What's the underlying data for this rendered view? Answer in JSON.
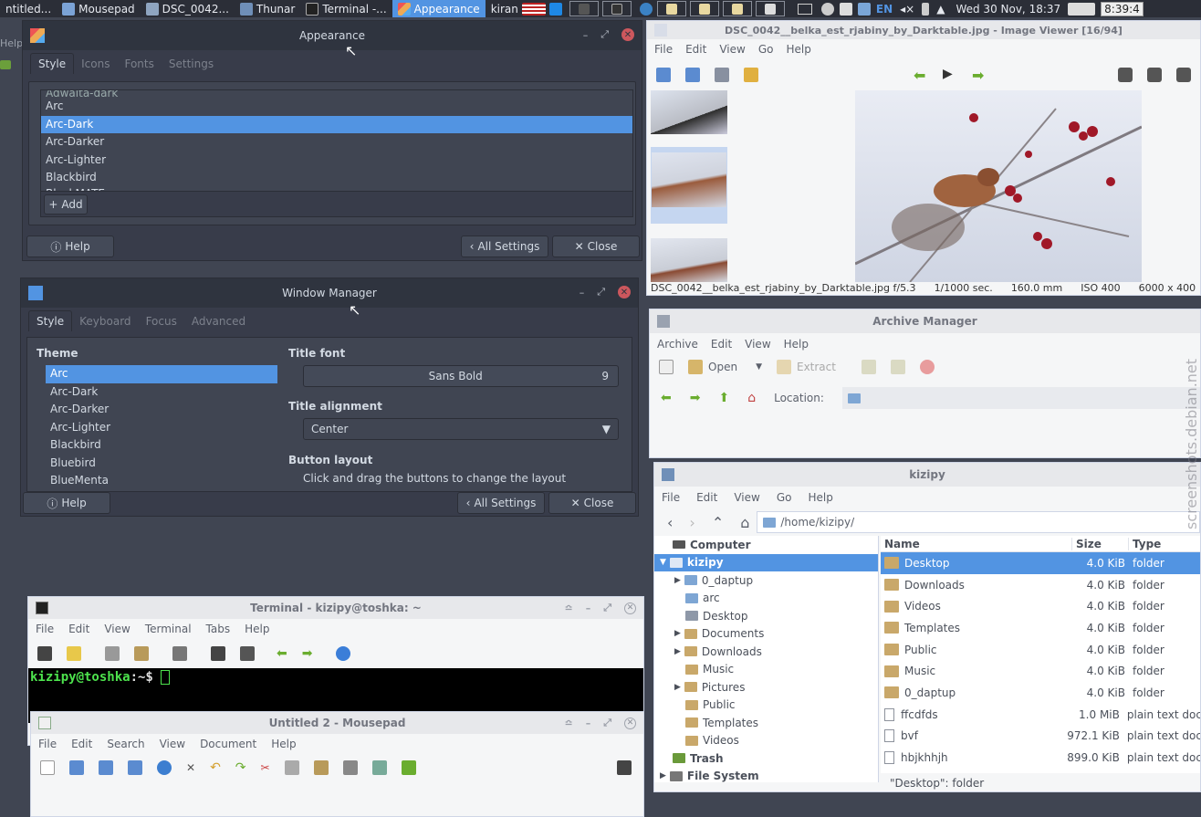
{
  "taskbar": {
    "tasks": [
      {
        "label": "ntitled...",
        "active": false
      },
      {
        "label": "Mousepad",
        "active": false
      },
      {
        "label": "DSC_0042...",
        "active": false
      },
      {
        "label": "Thunar",
        "active": false
      },
      {
        "label": "Terminal -...",
        "active": false
      },
      {
        "label": "Appearance",
        "active": true
      },
      {
        "label": "kiran",
        "active": false
      }
    ],
    "lang": "EN",
    "datetime": "Wed 30 Nov, 18:37",
    "clock": "8:39:4"
  },
  "appearance": {
    "title": "Appearance",
    "tabs": [
      "Style",
      "Icons",
      "Fonts",
      "Settings"
    ],
    "themes_partial_top": "Adwaita-dark",
    "themes": [
      "Arc",
      "Arc-Dark",
      "Arc-Darker",
      "Arc-Lighter",
      "Blackbird"
    ],
    "selected": "Arc-Dark",
    "themes_partial_bottom": "BlackMATE",
    "add_label": "Add",
    "help_label": "Help",
    "all_settings_label": "All Settings",
    "close_label": "Close"
  },
  "window_manager": {
    "title": "Window Manager",
    "tabs": [
      "Style",
      "Keyboard",
      "Focus",
      "Advanced"
    ],
    "theme_label": "Theme",
    "themes": [
      "Arc",
      "Arc-Dark",
      "Arc-Darker",
      "Arc-Lighter",
      "Blackbird",
      "Bluebird",
      "BlueMenta"
    ],
    "selected": "Arc",
    "title_font_label": "Title font",
    "title_font_value": "Sans Bold",
    "title_font_size": "9",
    "title_alignment_label": "Title alignment",
    "title_alignment_value": "Center",
    "button_layout_label": "Button layout",
    "button_layout_hint": "Click and drag the buttons to change the layout",
    "help_label": "Help",
    "all_settings_label": "All Settings",
    "close_label": "Close"
  },
  "image_viewer": {
    "title": "DSC_0042__belka_est_rjabiny_by_Darktable.jpg - Image Viewer [16/94]",
    "menu": [
      "File",
      "Edit",
      "View",
      "Go",
      "Help"
    ],
    "status_filename": "DSC_0042__belka_est_rjabiny_by_Darktable.jpg",
    "aperture": "f/5.3",
    "shutter": "1/1000 sec.",
    "focal": "160.0 mm",
    "iso": "ISO 400",
    "dimensions": "6000 x 400"
  },
  "archive_manager": {
    "title": "Archive Manager",
    "menu": [
      "Archive",
      "Edit",
      "View",
      "Help"
    ],
    "open_label": "Open",
    "extract_label": "Extract",
    "location_label": "Location:"
  },
  "thunar": {
    "title": "kizipy",
    "menu": [
      "File",
      "Edit",
      "View",
      "Go",
      "Help"
    ],
    "path": "/home/kizipy/",
    "side": [
      {
        "label": "Computer",
        "bold": true,
        "indent": 0
      },
      {
        "label": "kizipy",
        "bold": true,
        "indent": 0,
        "selected": true
      },
      {
        "label": "0_daptup",
        "indent": 2,
        "arrow": true
      },
      {
        "label": "arc",
        "indent": 2
      },
      {
        "label": "Desktop",
        "indent": 2
      },
      {
        "label": "Documents",
        "indent": 2,
        "arrow": true
      },
      {
        "label": "Downloads",
        "indent": 2,
        "arrow": true
      },
      {
        "label": "Music",
        "indent": 2
      },
      {
        "label": "Pictures",
        "indent": 2,
        "arrow": true
      },
      {
        "label": "Public",
        "indent": 2
      },
      {
        "label": "Templates",
        "indent": 2
      },
      {
        "label": "Videos",
        "indent": 2
      },
      {
        "label": "Trash",
        "bold": true,
        "indent": 0
      },
      {
        "label": "File System",
        "bold": true,
        "indent": 0
      }
    ],
    "columns": {
      "name": "Name",
      "size": "Size",
      "type": "Type"
    },
    "files": [
      {
        "name": "Desktop",
        "size": "4.0 KiB",
        "type": "folder",
        "kind": "folder"
      },
      {
        "name": "Downloads",
        "size": "4.0 KiB",
        "type": "folder",
        "kind": "folder"
      },
      {
        "name": "Videos",
        "size": "4.0 KiB",
        "type": "folder",
        "kind": "folder"
      },
      {
        "name": "Templates",
        "size": "4.0 KiB",
        "type": "folder",
        "kind": "folder"
      },
      {
        "name": "Public",
        "size": "4.0 KiB",
        "type": "folder",
        "kind": "folder"
      },
      {
        "name": "Music",
        "size": "4.0 KiB",
        "type": "folder",
        "kind": "folder"
      },
      {
        "name": "0_daptup",
        "size": "4.0 KiB",
        "type": "folder",
        "kind": "folder"
      },
      {
        "name": "ffcdfds",
        "size": "1.0 MiB",
        "type": "plain text doc",
        "kind": "doc"
      },
      {
        "name": "bvf",
        "size": "972.1 KiB",
        "type": "plain text doc",
        "kind": "doc"
      },
      {
        "name": "hbjkhhjh",
        "size": "899.0 KiB",
        "type": "plain text doc",
        "kind": "doc"
      }
    ],
    "status": "\"Desktop\": folder"
  },
  "terminal": {
    "title": "Terminal - kizipy@toshka: ~",
    "menu": [
      "File",
      "Edit",
      "View",
      "Terminal",
      "Tabs",
      "Help"
    ],
    "prompt_user": "kizipy@toshka",
    "prompt_path": ":~$"
  },
  "mousepad": {
    "title": "Untitled 2 - Mousepad",
    "menu": [
      "File",
      "Edit",
      "Search",
      "View",
      "Document",
      "Help"
    ]
  },
  "left_strip": {
    "help": "Help"
  },
  "watermark": "screenshots.debian.net"
}
